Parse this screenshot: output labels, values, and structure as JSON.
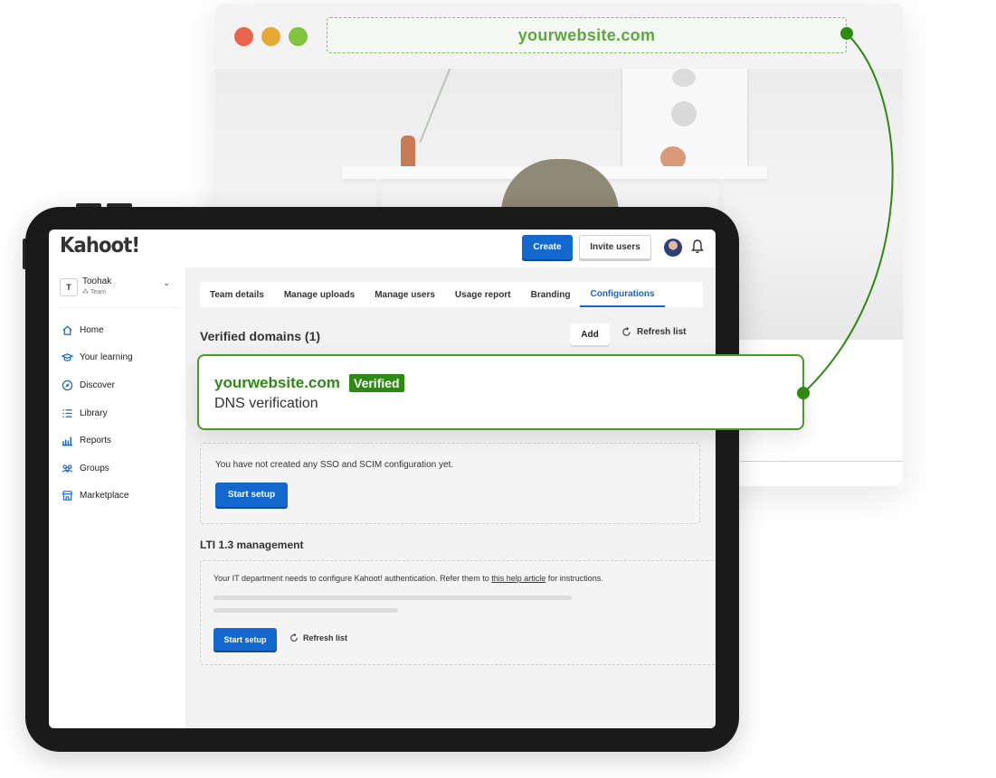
{
  "browser": {
    "url": "yourwebsite.com"
  },
  "app": {
    "logo": "Kahoot!",
    "create_label": "Create",
    "invite_label": "Invite users"
  },
  "sidebar": {
    "team_initial": "T",
    "team_name": "Toohak",
    "team_type": "Team",
    "items": [
      {
        "label": "Home",
        "icon": "home-icon"
      },
      {
        "label": "Your learning",
        "icon": "graduation-cap-icon"
      },
      {
        "label": "Discover",
        "icon": "compass-icon"
      },
      {
        "label": "Library",
        "icon": "list-icon"
      },
      {
        "label": "Reports",
        "icon": "bar-chart-icon"
      },
      {
        "label": "Groups",
        "icon": "groups-icon"
      },
      {
        "label": "Marketplace",
        "icon": "store-icon"
      }
    ]
  },
  "tabs": [
    "Team details",
    "Manage uploads",
    "Manage users",
    "Usage report",
    "Branding",
    "Configurations"
  ],
  "active_tab": "Configurations",
  "verified_domains": {
    "title": "Verified domains (1)",
    "add_label": "Add",
    "refresh_label": "Refresh list"
  },
  "callout": {
    "domain": "yourwebsite.com",
    "status": "Verified",
    "method": "DNS verification"
  },
  "sso": {
    "message": "You have not created any SSO and SCIM configuration yet.",
    "button_label": "Start setup"
  },
  "lti": {
    "title": "LTI 1.3 management",
    "message_before": "Your IT department needs to configure Kahoot! authentication. Refer them to ",
    "link_text": "this help article",
    "message_after": " for instructions.",
    "button_label": "Start setup",
    "refresh_label": "Refresh list"
  },
  "colors": {
    "accent_blue": "#1368ce",
    "verified_green": "#2e8a12",
    "url_green": "#5fa63e"
  }
}
